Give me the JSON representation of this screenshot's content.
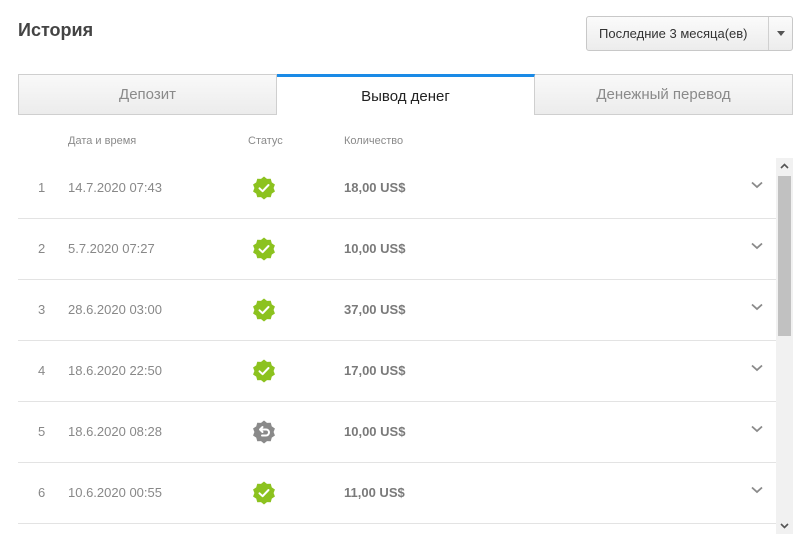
{
  "header": {
    "title": "История"
  },
  "period": {
    "selected": "Последние 3 месяца(ев)"
  },
  "tabs": [
    {
      "label": "Депозит",
      "active": false
    },
    {
      "label": "Вывод денег",
      "active": true
    },
    {
      "label": "Денежный перевод",
      "active": false
    }
  ],
  "columns": {
    "date": "Дата и время",
    "status": "Статус",
    "amount": "Количество"
  },
  "rows": [
    {
      "num": "1",
      "date": "14.7.2020 07:43",
      "status": "completed",
      "amount": "18,00 US$"
    },
    {
      "num": "2",
      "date": "5.7.2020 07:27",
      "status": "completed",
      "amount": "10,00 US$"
    },
    {
      "num": "3",
      "date": "28.6.2020 03:00",
      "status": "completed",
      "amount": "37,00 US$"
    },
    {
      "num": "4",
      "date": "18.6.2020 22:50",
      "status": "completed",
      "amount": "17,00 US$"
    },
    {
      "num": "5",
      "date": "18.6.2020 08:28",
      "status": "returned",
      "amount": "10,00 US$"
    },
    {
      "num": "6",
      "date": "10.6.2020 00:55",
      "status": "completed",
      "amount": "11,00 US$"
    }
  ],
  "colors": {
    "accent": "#1a8ae6",
    "status_completed": "#8cc21f",
    "status_returned": "#8a8a8a"
  },
  "icons": {
    "status_completed": "badge-check-icon",
    "status_returned": "badge-return-icon",
    "expand": "chevron-down-icon"
  }
}
